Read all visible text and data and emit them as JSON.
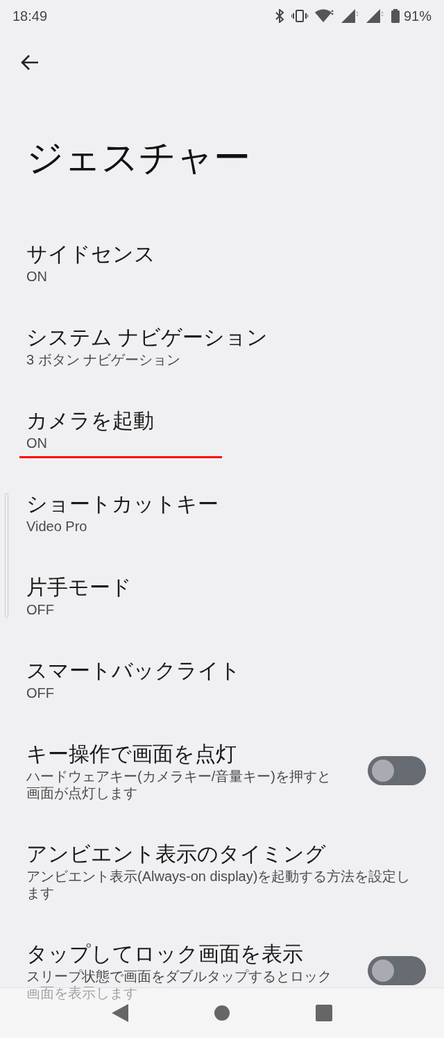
{
  "status_bar": {
    "time": "18:49",
    "battery": "91%"
  },
  "title": "ジェスチャー",
  "settings": [
    {
      "kind": "summary",
      "title": "サイドセンス",
      "summary": "ON"
    },
    {
      "kind": "summary",
      "title": "システム ナビゲーション",
      "summary": "3 ボタン ナビゲーション"
    },
    {
      "kind": "summary",
      "title": "カメラを起動",
      "summary": "ON",
      "underlined": true
    },
    {
      "kind": "summary",
      "title": "ショートカットキー",
      "summary": "Video Pro"
    },
    {
      "kind": "summary",
      "title": "片手モード",
      "summary": "OFF"
    },
    {
      "kind": "summary",
      "title": "スマートバックライト",
      "summary": "OFF"
    },
    {
      "kind": "toggle",
      "title": "キー操作で画面を点灯",
      "summary": "ハードウェアキー(カメラキー/音量キー)を押すと画面が点灯します",
      "on": false
    },
    {
      "kind": "summary",
      "title": "アンビエント表示のタイミング",
      "summary": "アンビエント表示(Always-on display)を起動する方法を設定します"
    },
    {
      "kind": "toggle",
      "title": "タップしてロック画面を表示",
      "summary": "スリープ状態で画面をダブルタップするとロック画面を表示します",
      "on": false
    }
  ]
}
